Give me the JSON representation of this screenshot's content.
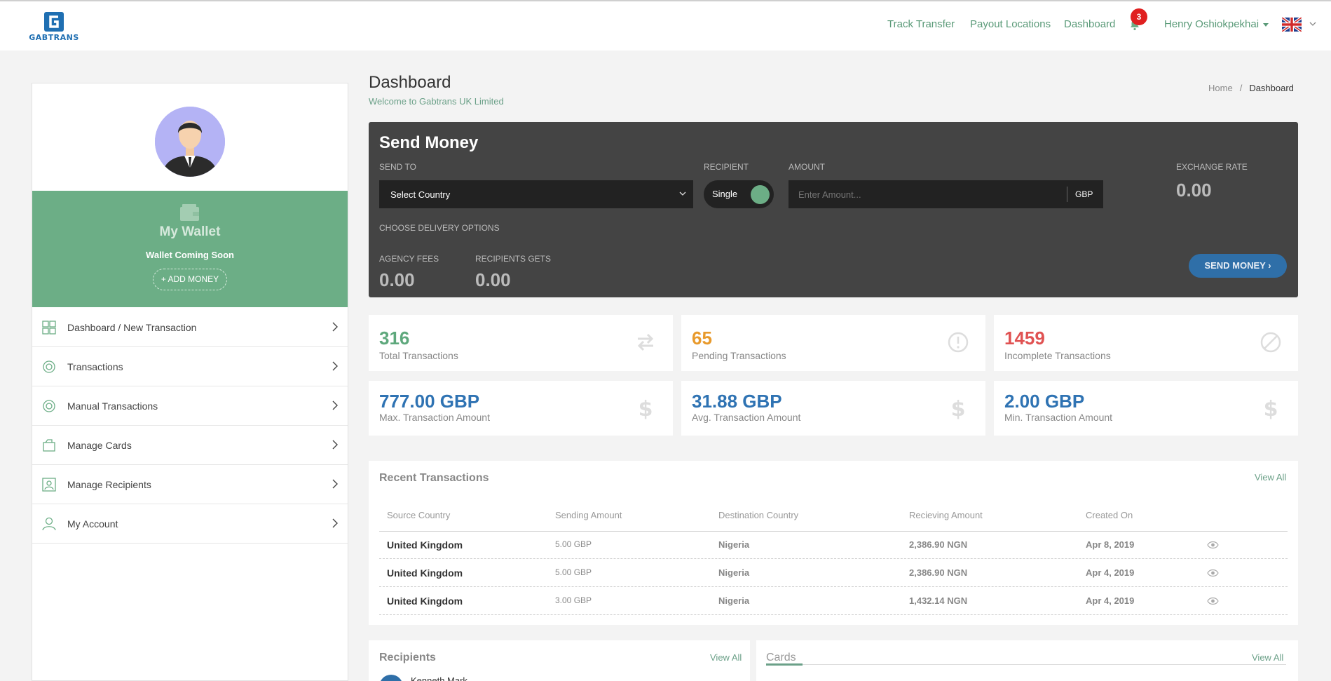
{
  "brand": {
    "name": "GABTRANS"
  },
  "nav": {
    "links": [
      "Track Transfer",
      "Payout Locations",
      "Dashboard"
    ],
    "notifications_count": "3",
    "user_name": "Henry Oshiokpekhai"
  },
  "sidebar": {
    "wallet_title": "My Wallet",
    "wallet_status": "Wallet Coming Soon",
    "add_money": "+ ADD MONEY",
    "items": [
      {
        "label": "Dashboard / New Transaction",
        "icon": "dashboard-icon"
      },
      {
        "label": "Transactions",
        "icon": "transactions-icon"
      },
      {
        "label": "Manual Transactions",
        "icon": "manual-transactions-icon"
      },
      {
        "label": "Manage Cards",
        "icon": "cards-icon"
      },
      {
        "label": "Manage Recipients",
        "icon": "recipients-icon"
      },
      {
        "label": "My Account",
        "icon": "user-icon"
      }
    ]
  },
  "page": {
    "title": "Dashboard",
    "subtitle": "Welcome to Gabtrans UK Limited",
    "breadcrumb": [
      "Home",
      "Dashboard"
    ]
  },
  "send_money": {
    "title": "Send Money",
    "send_to_label": "SEND TO",
    "country_value": "Select Country",
    "recipient_label": "RECIPIENT",
    "recipient_value": "Single",
    "amount_label": "AMOUNT",
    "amount_placeholder": "Enter Amount...",
    "currency": "GBP",
    "exchange_rate_label": "EXCHANGE RATE",
    "exchange_rate": "0.00",
    "delivery_label": "CHOOSE DELIVERY OPTIONS",
    "agency_fees_label": "AGENCY FEES",
    "agency_fees": "0.00",
    "recipient_gets_label": "RECIPIENTS GETS",
    "recipient_gets": "0.00",
    "button": "SEND MONEY ›"
  },
  "stats": [
    {
      "value": "316",
      "label": "Total Transactions",
      "color": "#5ea87c",
      "icon": "transfer-arrows-icon"
    },
    {
      "value": "65",
      "label": "Pending Transactions",
      "color": "#e89a2c",
      "icon": "exclamation-circle-icon"
    },
    {
      "value": "1459",
      "label": "Incomplete Transactions",
      "color": "#e05252",
      "icon": "ban-icon"
    },
    {
      "value": "777.00 GBP",
      "label": "Max. Transaction Amount",
      "color": "#2f73b3",
      "icon": "dollar-icon"
    },
    {
      "value": "31.88 GBP",
      "label": "Avg. Transaction Amount",
      "color": "#2f73b3",
      "icon": "dollar-icon"
    },
    {
      "value": "2.00 GBP",
      "label": "Min. Transaction Amount",
      "color": "#2f73b3",
      "icon": "dollar-icon"
    }
  ],
  "recent": {
    "title": "Recent Transactions",
    "view_all": "View All",
    "columns": [
      "Source Country",
      "Sending Amount",
      "Destination Country",
      "Recieving Amount",
      "Created On"
    ],
    "rows": [
      [
        "United Kingdom",
        "5.00 GBP",
        "Nigeria",
        "2,386.90 NGN",
        "Apr 8, 2019"
      ],
      [
        "United Kingdom",
        "5.00 GBP",
        "Nigeria",
        "2,386.90 NGN",
        "Apr 4, 2019"
      ],
      [
        "United Kingdom",
        "3.00 GBP",
        "Nigeria",
        "1,432.14 NGN",
        "Apr 4, 2019"
      ]
    ]
  },
  "recipients": {
    "title": "Recipients",
    "view_all": "View All",
    "first_name": "Kenneth Mark"
  },
  "cards": {
    "tab": "Cards",
    "view_all": "View All"
  },
  "colors": {
    "accent": "#6cae86",
    "panel": "#444444",
    "button": "#2f6fa8"
  }
}
